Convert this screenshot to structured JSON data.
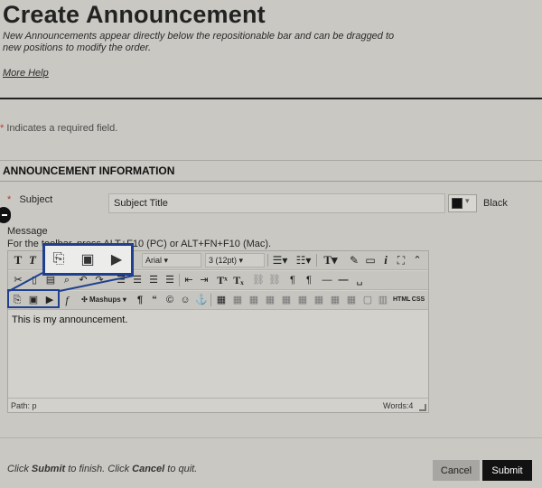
{
  "header": {
    "title": "Create Announcement",
    "instructions": "New Announcements appear directly below the repositionable bar and can be dragged to new positions to modify the order.",
    "more_help": "More Help"
  },
  "required_note": {
    "star": "*",
    "text": "Indicates a required field."
  },
  "section": {
    "title": "ANNOUNCEMENT INFORMATION"
  },
  "subject": {
    "star": "*",
    "label": "Subject",
    "value": "Subject Title",
    "color_name": "Black",
    "color_value": "#000000"
  },
  "message": {
    "label": "Message",
    "shortcut_hint": "For the toolbar, press ALT+F10 (PC) or ALT+FN+F10 (Mac)."
  },
  "editor": {
    "toolbar1": {
      "font_family": "Arial",
      "font_size": "3 (12pt)"
    },
    "toolbar3": {
      "mashups": "Mashups",
      "html_label": "HTML",
      "css_label": "CSS"
    },
    "content": "This is my announcement.",
    "path": "Path: p",
    "word_count": "Words:4"
  },
  "footer": {
    "hint_prefix": "Click ",
    "hint_submit": "Submit",
    "hint_middle": " to finish. Click ",
    "hint_cancel": "Cancel",
    "hint_suffix": " to quit.",
    "cancel_label": "Cancel",
    "submit_label": "Submit"
  },
  "colors": {
    "accent_callout": "#1f3f8f",
    "submit_bg": "#121212",
    "required_star": "#c0392b"
  }
}
